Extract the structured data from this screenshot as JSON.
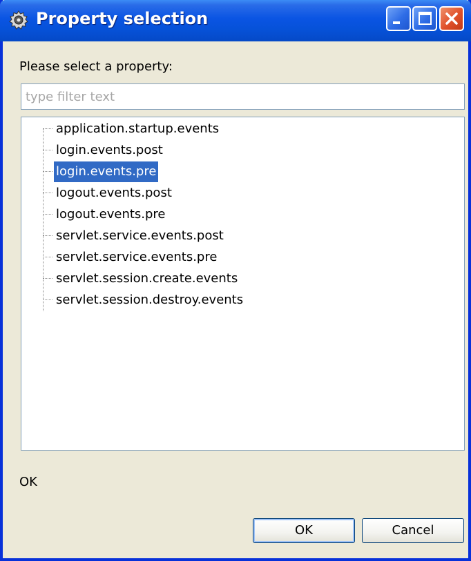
{
  "window": {
    "title": "Property selection",
    "controls": [
      "minimize-icon",
      "maximize-icon",
      "close-icon"
    ],
    "colors": {
      "titlebar": "#0a54e3",
      "frame": "#0831d9",
      "body": "#ece9d8",
      "selection": "#316ac5"
    }
  },
  "prompt": "Please select a property:",
  "filter": {
    "placeholder": "type filter text",
    "value": ""
  },
  "tree": {
    "items": [
      {
        "label": "application.startup.events",
        "selected": false
      },
      {
        "label": "login.events.post",
        "selected": false
      },
      {
        "label": "login.events.pre",
        "selected": true
      },
      {
        "label": "logout.events.post",
        "selected": false
      },
      {
        "label": "logout.events.pre",
        "selected": false
      },
      {
        "label": "servlet.service.events.post",
        "selected": false
      },
      {
        "label": "servlet.service.events.pre",
        "selected": false
      },
      {
        "label": "servlet.session.create.events",
        "selected": false
      },
      {
        "label": "servlet.session.destroy.events",
        "selected": false
      }
    ]
  },
  "status": "OK",
  "buttons": {
    "ok": "OK",
    "cancel": "Cancel"
  }
}
